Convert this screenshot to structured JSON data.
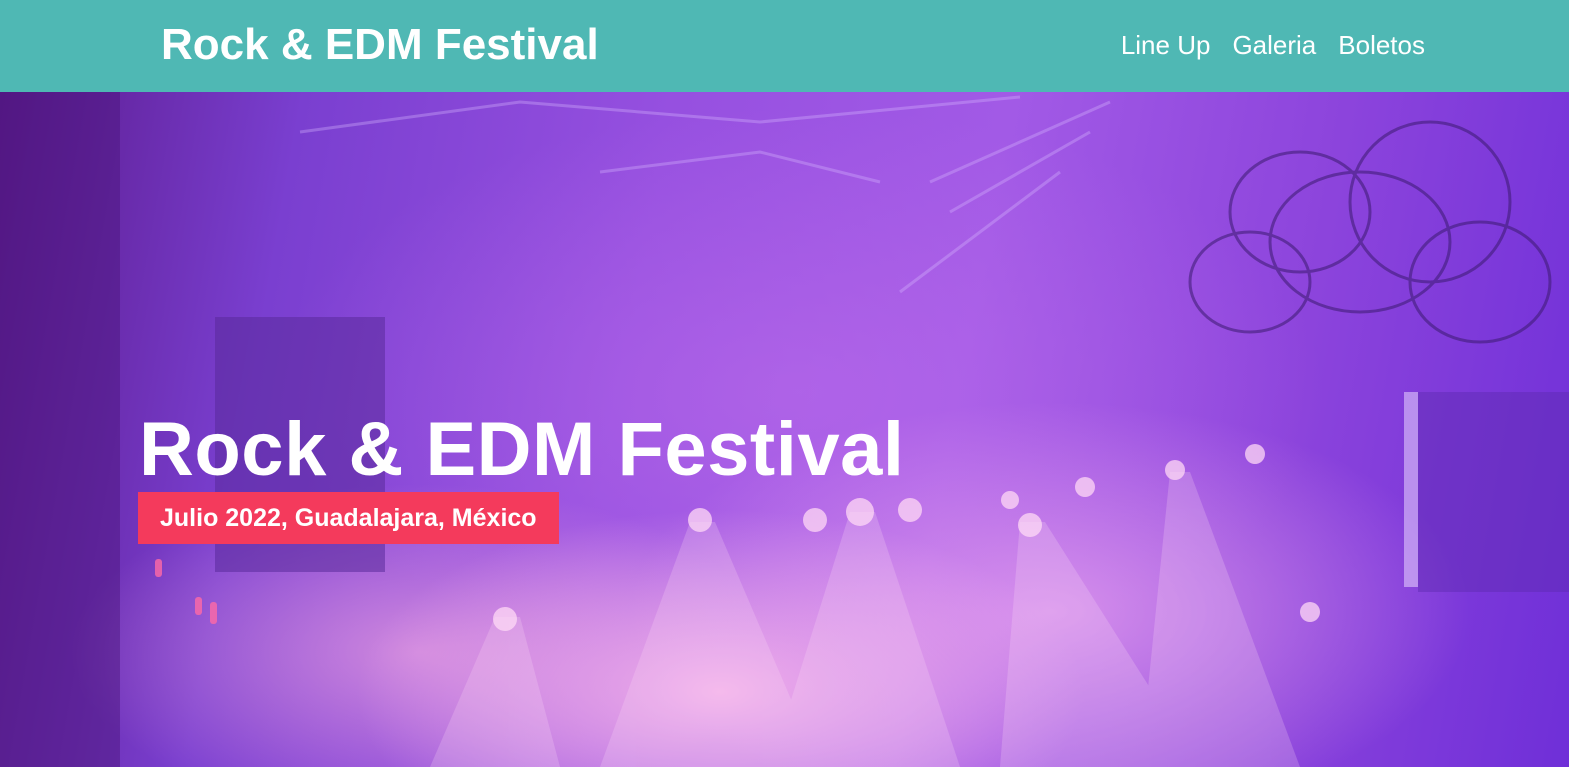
{
  "header": {
    "site_title": "Rock & EDM Festival",
    "nav": [
      {
        "label": "Line Up"
      },
      {
        "label": "Galeria"
      },
      {
        "label": "Boletos"
      }
    ]
  },
  "hero": {
    "title": "Rock & EDM Festival",
    "subtitle": "Julio 2022, Guadalajara, México",
    "background_image": "concert-stage-photo"
  },
  "colors": {
    "header_bg": "#4fb8b4",
    "badge_bg": "#f43a5c",
    "text": "#ffffff",
    "hero_tint": "#9650e0"
  }
}
